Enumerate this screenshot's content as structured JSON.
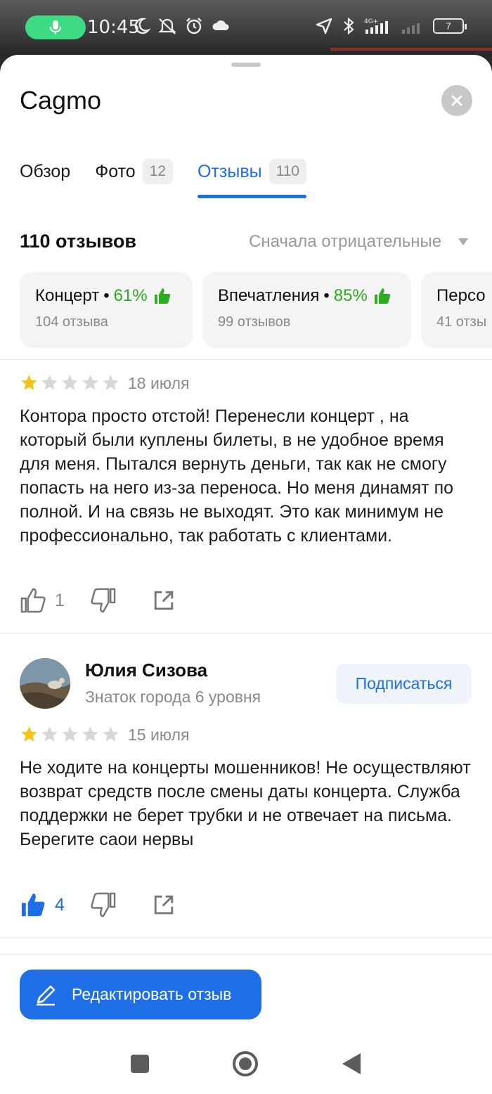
{
  "status_bar": {
    "time": "10:45",
    "battery": "7",
    "network": "4G+"
  },
  "header": {
    "title": "Cagmo"
  },
  "tabs": [
    {
      "label": "Обзор",
      "count": ""
    },
    {
      "label": "Фото",
      "count": "12"
    },
    {
      "label": "Отзывы",
      "count": "110",
      "active": true
    }
  ],
  "reviews_summary": {
    "count_label": "110 отзывов",
    "sort_label": "Сначала отрицательные"
  },
  "aspects": [
    {
      "name": "Концерт",
      "percent": "61%",
      "sub": "104 отзыва"
    },
    {
      "name": "Впечатления",
      "percent": "85%",
      "sub": "99 отзывов"
    },
    {
      "name": "Персо",
      "percent": "",
      "sub": "41 отзы"
    }
  ],
  "reviews": [
    {
      "rating": 1,
      "date": "18 июля",
      "text": "Контора просто отстой! Перенесли концерт , на который были куплены билеты, в не удобное время для меня. Пытался вернуть деньги, так как не смогу попасть на него из-за переноса. Но меня динамят по полной. И на связь не выходят. Это как минимум не профессионально, так работать с клиентами.",
      "likes": "1",
      "liked": false
    },
    {
      "author": "Юлия Сизова",
      "author_subtitle": "Знаток города 6 уровня",
      "subscribe_label": "Подписаться",
      "rating": 1,
      "date": "15 июля",
      "text": "Не ходите на концерты мошенников! Не осуществляют возврат средств после смены даты концерта. Служба поддержки не берет трубки и не отвечает на письма. Берегите саои нервы",
      "likes": "4",
      "liked": true
    }
  ],
  "edit_button": {
    "label": "Редактировать отзыв"
  },
  "colors": {
    "accent": "#1e6ee6",
    "positive": "#2eab22",
    "star": "#f6c318"
  }
}
